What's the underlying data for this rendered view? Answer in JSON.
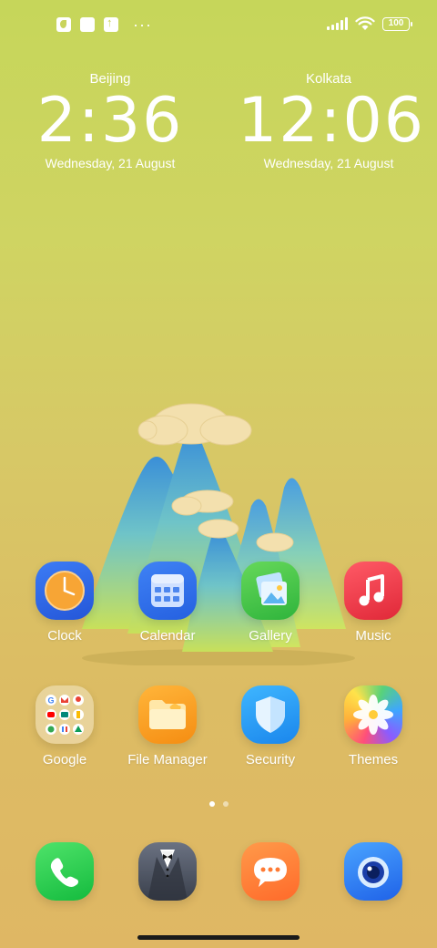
{
  "status_bar": {
    "battery": "100",
    "left_icons": [
      "notification-app-icon",
      "square-notification-icon",
      "upload-notification-icon"
    ],
    "more": "···"
  },
  "clocks": [
    {
      "city": "Beijing",
      "time": "2:36",
      "date": "Wednesday, 21 August"
    },
    {
      "city": "Kolkata",
      "time": "12:06",
      "date": "Wednesday, 21 August"
    }
  ],
  "apps_row1": [
    {
      "label": "Clock",
      "icon": "clock-icon"
    },
    {
      "label": "Calendar",
      "icon": "calendar-icon"
    },
    {
      "label": "Gallery",
      "icon": "gallery-icon"
    },
    {
      "label": "Music",
      "icon": "music-icon"
    }
  ],
  "apps_row2": [
    {
      "label": "Google",
      "icon": "google-folder-icon"
    },
    {
      "label": "File Manager",
      "icon": "folder-icon"
    },
    {
      "label": "Security",
      "icon": "shield-icon"
    },
    {
      "label": "Themes",
      "icon": "flower-icon"
    }
  ],
  "dock": [
    {
      "icon": "phone-icon"
    },
    {
      "icon": "contacts-icon"
    },
    {
      "icon": "messages-icon"
    },
    {
      "icon": "camera-icon"
    }
  ],
  "pages": {
    "count": 2,
    "active": 1
  }
}
